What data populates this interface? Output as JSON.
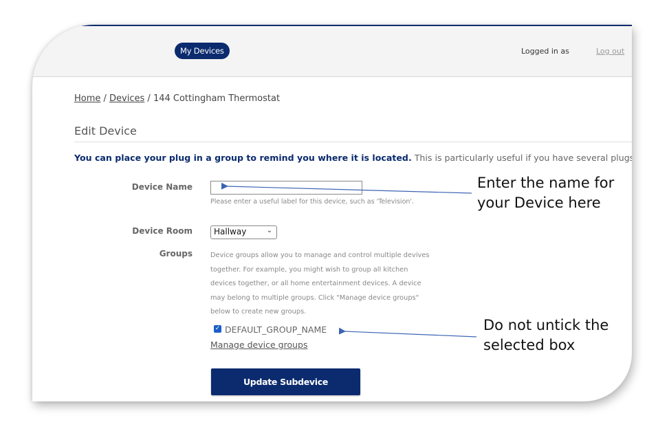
{
  "header": {
    "nav_button": "My Devices",
    "logged_in": "Logged in as",
    "logout": "Log out"
  },
  "breadcrumb": {
    "home": "Home",
    "sep1": " / ",
    "devices": "Devices",
    "sep2": " / ",
    "current": "144 Cottingham Thermostat"
  },
  "page": {
    "title": "Edit Device",
    "intro_strong": "You can place your plug in a group to remind you where it is located.",
    "intro_rest": " This is particularly useful if you have several plugs devices."
  },
  "form": {
    "device_name_label": "Device Name",
    "device_name_value": "",
    "device_name_help": "Please enter a useful label for this device, such as 'Television'.",
    "device_room_label": "Device Room",
    "device_room_value": "Hallway",
    "groups_label": "Groups",
    "groups_desc": "Device groups allow you to manage and control multiple devives together. For example, you might wish to group all kitchen devices together, or all home entertainment devices. A device may belong to multiple groups. Click \"Manage device groups\" below to create new groups.",
    "group_item": "DEFAULT_GROUP_NAME",
    "group_checked": true,
    "manage_link": "Manage device groups",
    "submit": "Update Subdevice"
  },
  "annotations": {
    "name_note": "Enter the name for your Device here",
    "group_note": "Do not untick the selected box"
  },
  "colors": {
    "brand_navy": "#0b2b6e",
    "arrow_blue": "#3b63b3",
    "checkbox_blue": "#1a5fc8"
  },
  "icons": {
    "select_chevron": "chevron-down-icon",
    "check": "checkmark-icon",
    "arrow": "arrow-left-icon"
  }
}
